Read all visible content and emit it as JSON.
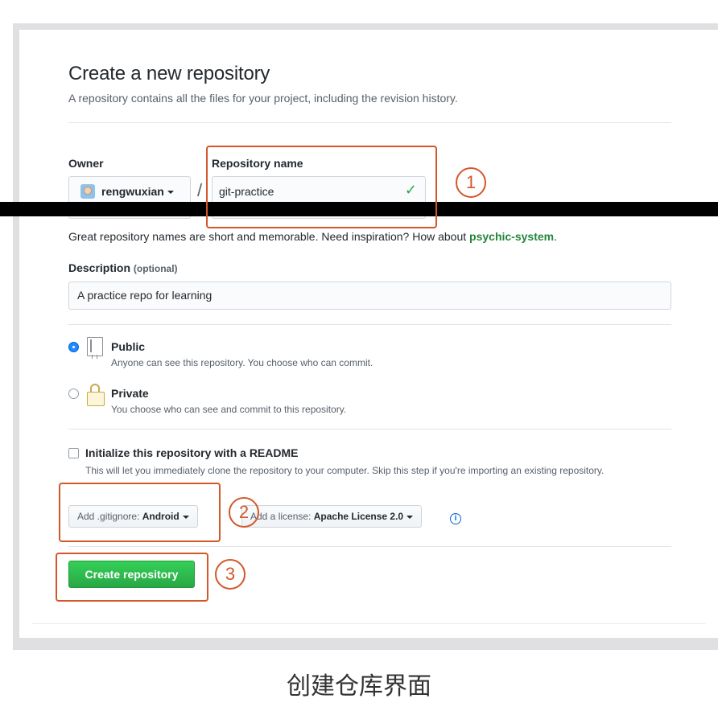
{
  "form": {
    "title": "Create a new repository",
    "subtitle": "A repository contains all the files for your project, including the revision history.",
    "owner_label": "Owner",
    "owner_value": "rengwuxian",
    "slash": "/",
    "repo_name_label": "Repository name",
    "repo_name_value": "git-practice",
    "hint_prefix": "Great repository names are short and memorable. Need inspiration? How about ",
    "hint_suggestion": "psychic-system",
    "hint_suffix": ".",
    "description_label": "Description",
    "description_optional": "(optional)",
    "description_value": "A practice repo for learning",
    "visibility": {
      "public_title": "Public",
      "public_desc": "Anyone can see this repository. You choose who can commit.",
      "private_title": "Private",
      "private_desc": "You choose who can see and commit to this repository.",
      "selected": "Public"
    },
    "readme": {
      "label": "Initialize this repository with a README",
      "desc": "This will let you immediately clone the repository to your computer. Skip this step if you're importing an existing repository."
    },
    "gitignore": {
      "prefix": "Add .gitignore: ",
      "value": "Android"
    },
    "license": {
      "prefix": "Add a license: ",
      "value": "Apache License 2.0"
    },
    "create_button": "Create repository"
  },
  "annotations": {
    "step1": "1",
    "step2": "2",
    "step3": "3",
    "color": "#d4572a"
  },
  "caption": "创建仓库界面"
}
